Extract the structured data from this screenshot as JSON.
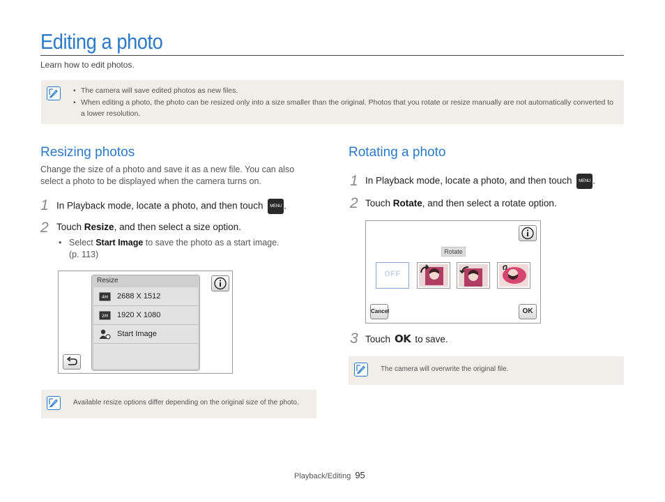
{
  "page": {
    "title": "Editing a photo",
    "subtitle": "Learn how to edit photos.",
    "top_note": {
      "icon": "note-icon",
      "bullets": [
        "The camera will save edited photos as new files.",
        "When editing a photo, the photo can be resized only into a size smaller than the original. Photos that you rotate or resize manually are not automatically converted to a lower resolution."
      ]
    }
  },
  "resize": {
    "heading": "Resizing photos",
    "intro": "Change the size of a photo and save it as a new file. You can also select a photo to be displayed when the camera turns on.",
    "step1": {
      "num": "1",
      "text": "In Playback mode, locate a photo, and then touch",
      "icon_label": "MENU",
      "after": "."
    },
    "step2": {
      "num": "2",
      "pre": "Touch ",
      "bold": "Resize",
      "post": ", and then select a size option."
    },
    "sub_bullet": {
      "pre": "Select ",
      "bold": "Start Image",
      "post": " to save the photo as a start image.",
      "ref": "(p. 113)"
    },
    "screen": {
      "menu_title": "Resize",
      "items": [
        {
          "label": "2688 X 1512",
          "icon": "resize-4m-icon"
        },
        {
          "label": "1920 X 1080",
          "icon": "resize-2m-icon"
        },
        {
          "label": "Start Image",
          "icon": "start-image-icon"
        }
      ],
      "info_icon": "info-icon",
      "back_icon": "back-icon"
    },
    "note": "Available resize options differ depending on the original size of the photo."
  },
  "rotate": {
    "heading": "Rotating a photo",
    "step1": {
      "num": "1",
      "text": "In Playback mode, locate a photo, and then touch",
      "icon_label": "MENU",
      "after": "."
    },
    "step2": {
      "num": "2",
      "pre": "Touch ",
      "bold": "Rotate",
      "post": ", and then select a rotate option."
    },
    "screen": {
      "label": "Rotate",
      "off_label": "OFF",
      "cancel_label": "Cancel",
      "ok_label": "OK",
      "info_icon": "info-icon"
    },
    "step3": {
      "num": "3",
      "pre": "Touch",
      "ok": "OK",
      "post": "to save."
    },
    "note": "The camera will overwrite the original file."
  },
  "footer": {
    "section": "Playback/Editing",
    "page_number": "95"
  },
  "colors": {
    "accent": "#2b7ac9",
    "note_bg": "#f1ede8"
  }
}
